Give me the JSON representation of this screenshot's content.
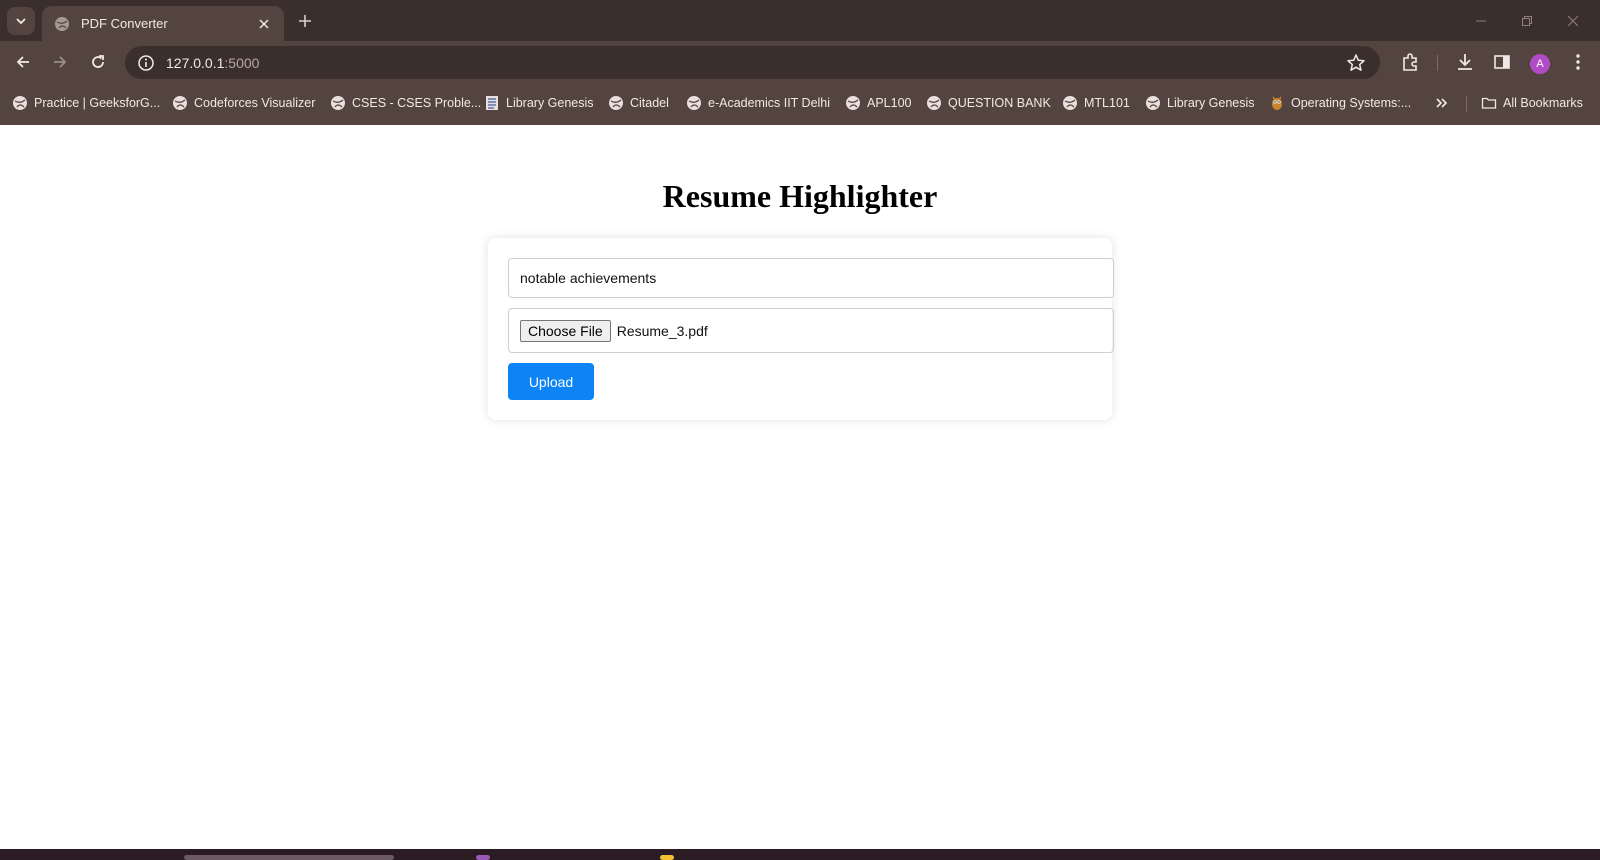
{
  "browser": {
    "tab_title": "PDF Converter",
    "url_host": "127.0.0.1",
    "url_port": ":5000",
    "profile_initial": "A"
  },
  "bookmarks": [
    {
      "label": "Practice | GeeksforG...",
      "icon": "globe-icon"
    },
    {
      "label": "Codeforces Visualizer",
      "icon": "globe-icon"
    },
    {
      "label": "CSES - CSES Proble...",
      "icon": "globe-icon"
    },
    {
      "label": "Library Genesis",
      "icon": "libgen-icon"
    },
    {
      "label": "Citadel",
      "icon": "globe-icon"
    },
    {
      "label": "e-Academics IIT Delhi",
      "icon": "globe-icon"
    },
    {
      "label": "APL100",
      "icon": "globe-icon"
    },
    {
      "label": "QUESTION BANK",
      "icon": "globe-icon"
    },
    {
      "label": "MTL101",
      "icon": "globe-icon"
    },
    {
      "label": "Library Genesis",
      "icon": "globe-icon"
    },
    {
      "label": "Operating Systems:...",
      "icon": "owl-icon"
    }
  ],
  "all_bookmarks_label": "All Bookmarks",
  "page": {
    "title": "Resume Highlighter",
    "query_value": "notable achievements",
    "choose_file_label": "Choose File",
    "file_name": "Resume_3.pdf",
    "upload_label": "Upload"
  },
  "colors": {
    "chrome_dark": "#3b2f2d",
    "chrome_light": "#54443f",
    "upload_button": "#0d84f5"
  }
}
